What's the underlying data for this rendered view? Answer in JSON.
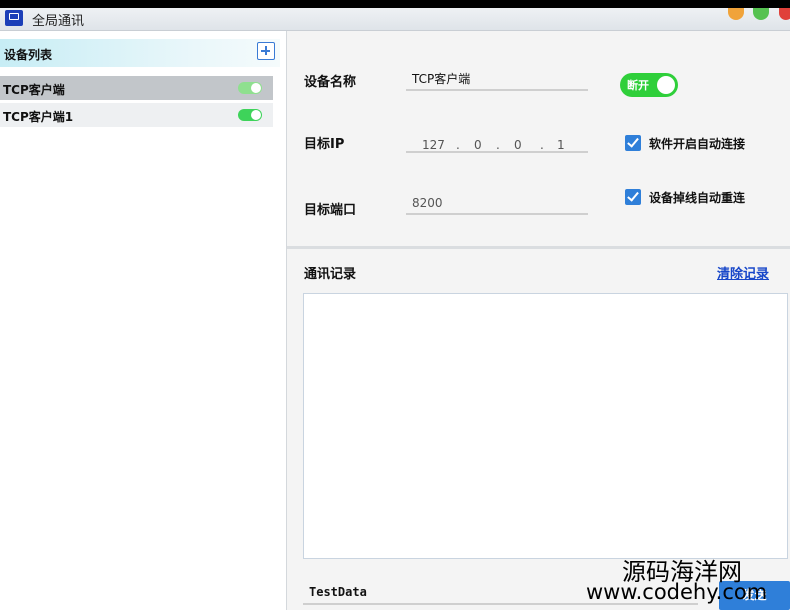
{
  "window": {
    "title": "全局通讯",
    "colors": {
      "accent": "#2f7fd9",
      "toggle_on": "#2fcf3a",
      "link": "#1847c9"
    }
  },
  "device_list": {
    "title": "设备列表",
    "add_icon": "plus-icon",
    "items": [
      {
        "label": "TCP客户端",
        "selected": true,
        "enabled": true
      },
      {
        "label": "TCP客户端1",
        "selected": false,
        "enabled": true
      }
    ]
  },
  "config": {
    "device_name_label": "设备名称",
    "device_name_value": "TCP客户端",
    "toggle_label": "断开",
    "target_ip_label": "目标IP",
    "target_ip": [
      "127",
      "0",
      "0",
      "1"
    ],
    "target_port_label": "目标端口",
    "target_port_value": "8200",
    "auto_connect_label": "软件开启自动连接",
    "auto_connect_checked": true,
    "auto_reconnect_label": "设备掉线自动重连",
    "auto_reconnect_checked": true
  },
  "log": {
    "title": "通讯记录",
    "clear_label": "清除记录",
    "content": ""
  },
  "send": {
    "input_value": "TestData",
    "button_label": "发送"
  },
  "watermark": {
    "cn": "源码海洋网",
    "url": "www.codehy.com"
  }
}
